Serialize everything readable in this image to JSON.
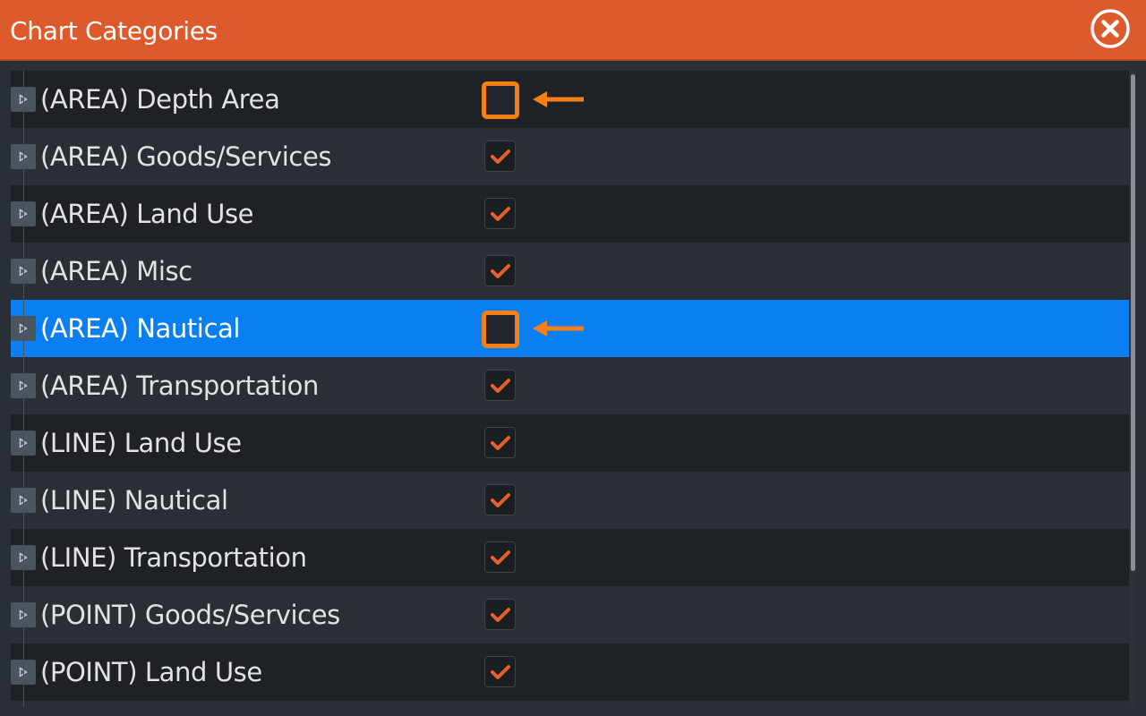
{
  "dialog": {
    "title": "Chart Categories",
    "close_icon": "close-icon",
    "accent_color": "#dd5a2d",
    "selection_color": "#0a7ff2",
    "highlight_color": "#f57e16"
  },
  "categories": [
    {
      "label": "(AREA) Depth Area",
      "checked": false,
      "highlighted": true
    },
    {
      "label": "(AREA) Goods/Services",
      "checked": true
    },
    {
      "label": "(AREA) Land Use",
      "checked": true
    },
    {
      "label": "(AREA) Misc",
      "checked": true
    },
    {
      "label": "(AREA) Nautical",
      "checked": false,
      "selected": true,
      "highlighted": true
    },
    {
      "label": "(AREA) Transportation",
      "checked": true
    },
    {
      "label": "(LINE) Land Use",
      "checked": true
    },
    {
      "label": "(LINE) Nautical",
      "checked": true
    },
    {
      "label": "(LINE) Transportation",
      "checked": true
    },
    {
      "label": "(POINT) Goods/Services",
      "checked": true
    },
    {
      "label": "(POINT) Land Use",
      "checked": true
    }
  ]
}
